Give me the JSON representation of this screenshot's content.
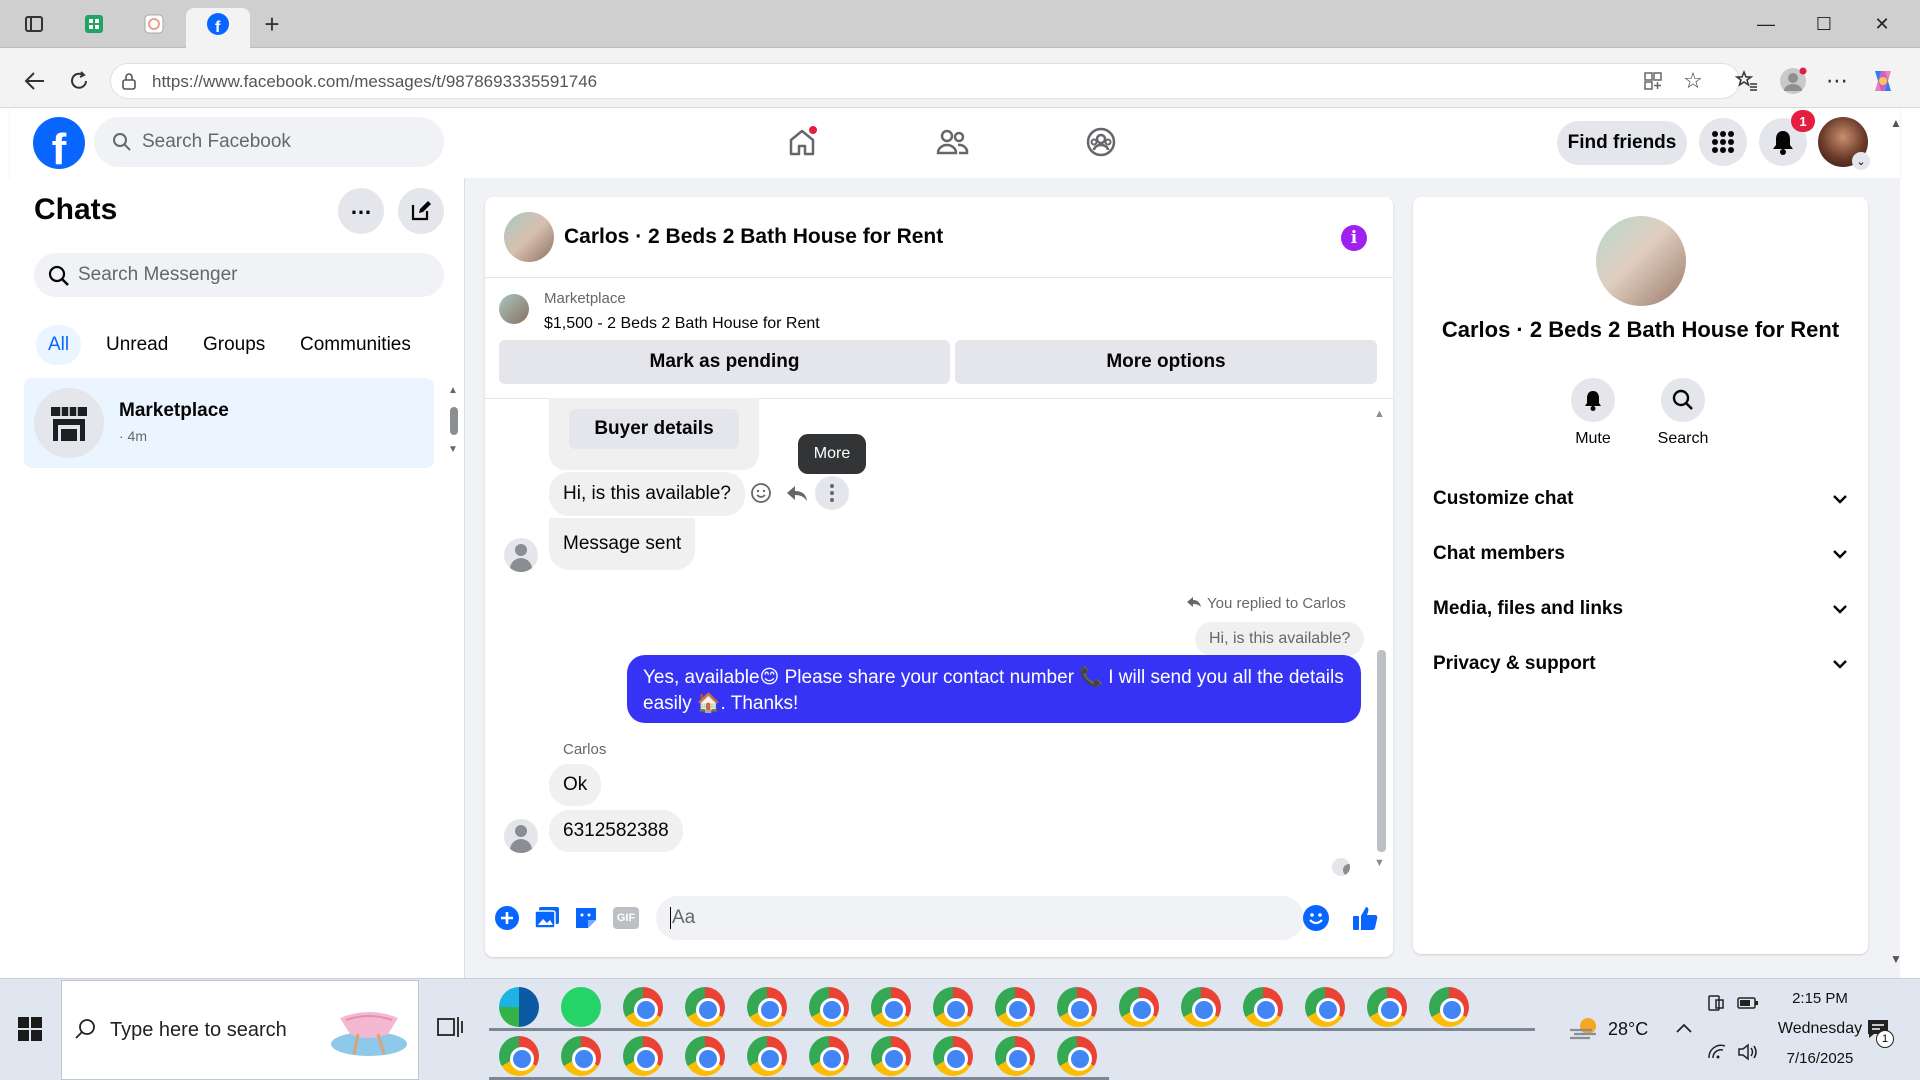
{
  "browser": {
    "url": "https://www.facebook.com/messages/t/9878693335591746",
    "new_tab_label": "+"
  },
  "fb": {
    "search_placeholder": "Search Facebook",
    "find_friends_label": "Find friends",
    "notification_count": "1"
  },
  "sidebar": {
    "title": "Chats",
    "search_placeholder": "Search Messenger",
    "filters": [
      "All",
      "Unread",
      "Groups",
      "Communities"
    ],
    "chat_item": {
      "name": "Marketplace",
      "time": "· 4m"
    }
  },
  "chat": {
    "title": "Carlos · 2 Beds 2 Bath House for Rent",
    "marketplace_label": "Marketplace",
    "listing": "$1,500 - 2 Beds 2 Bath House for Rent",
    "mark_pending_label": "Mark as pending",
    "more_options_label": "More options",
    "buyer_details_label": "Buyer details",
    "tooltip": "More",
    "messages": {
      "m1": "Hi, is this available?",
      "m2": "Message sent",
      "reply_note": "You replied to Carlos",
      "reply_quote": "Hi, is this available?",
      "sent_line1": "Yes, available😊 Please share your contact number 📞 I will send you all the details",
      "sent_line2": "easily 🏠. Thanks!",
      "sender_name": "Carlos",
      "m3": "Ok",
      "m4": "6312582388"
    },
    "composer_placeholder": "Aa",
    "gif_label": "GIF"
  },
  "right_panel": {
    "title": "Carlos · 2 Beds 2 Bath House for Rent",
    "mute_label": "Mute",
    "search_label": "Search",
    "sections": [
      "Customize chat",
      "Chat members",
      "Media, files and links",
      "Privacy & support"
    ]
  },
  "taskbar": {
    "search_placeholder": "Type here to search",
    "weather": "28°C",
    "time": "2:15 PM",
    "day": "Wednesday",
    "date": "7/16/2025",
    "notif_count": "1"
  }
}
